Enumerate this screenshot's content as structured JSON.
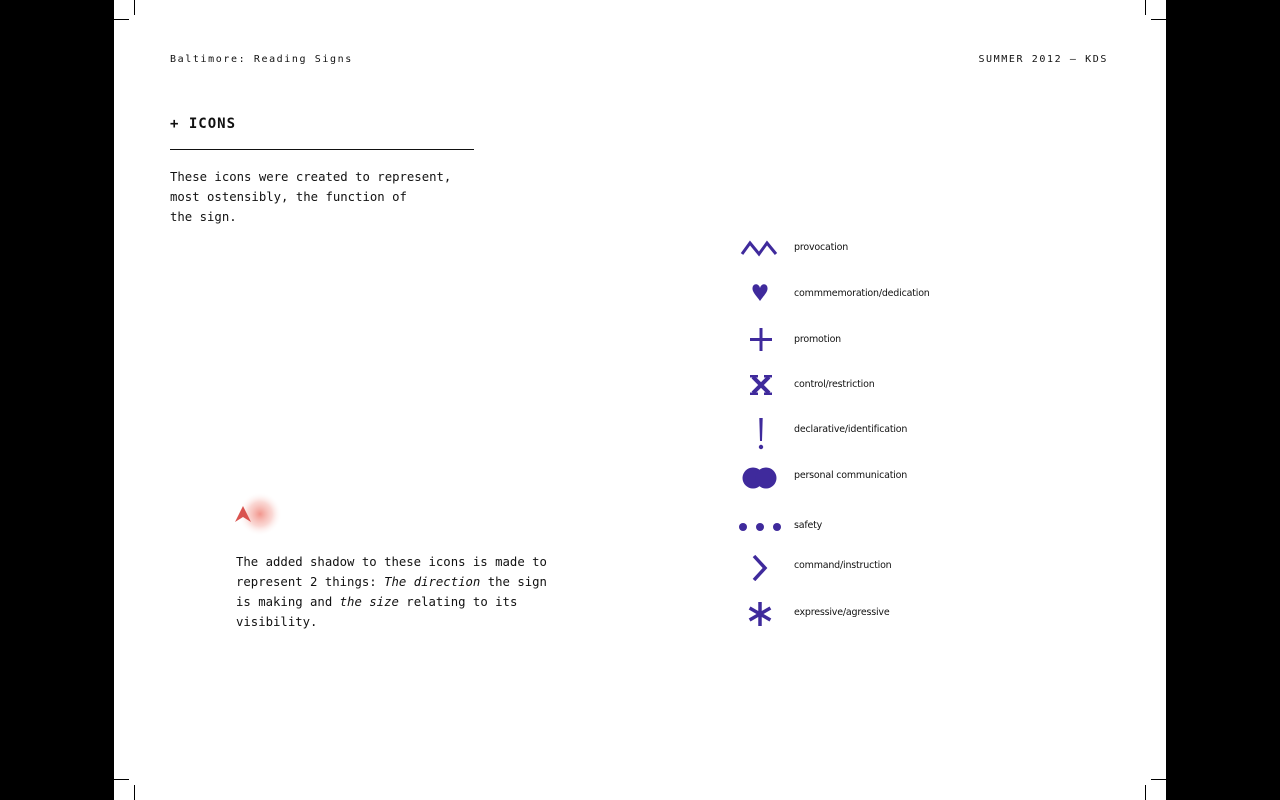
{
  "header": {
    "left": "Baltimore: Reading Signs",
    "right": "SUMMER 2012 – KDS"
  },
  "section": {
    "title": "+ ICONS",
    "intro": "These icons were created to represent,\nmost ostensibly, the function of\nthe sign."
  },
  "shadow_note": {
    "part1": "The added shadow to these icons is made to represent 2 things: ",
    "em1": "The direction",
    "part2": " the sign is making and ",
    "em2": "the size",
    "part3": " relating to its visibility."
  },
  "colors": {
    "icon": "#3f2a9c",
    "shadow_arrow": "#d9534f",
    "shadow_glow": "#f08a80"
  },
  "legend": [
    {
      "icon": "zigzag-icon",
      "label": "provocation"
    },
    {
      "icon": "heart-icon",
      "label": "commmemoration/dedication"
    },
    {
      "icon": "plus-icon",
      "label": "promotion"
    },
    {
      "icon": "x-icon",
      "label": "control/restriction"
    },
    {
      "icon": "exclamation-icon",
      "label": "declarative/identification"
    },
    {
      "icon": "double-circle-icon",
      "label": "personal communication"
    },
    {
      "icon": "dots-icon",
      "label": "safety"
    },
    {
      "icon": "chevron-right-icon",
      "label": "command/instruction"
    },
    {
      "icon": "asterisk-icon",
      "label": "expressive/agressive"
    }
  ]
}
